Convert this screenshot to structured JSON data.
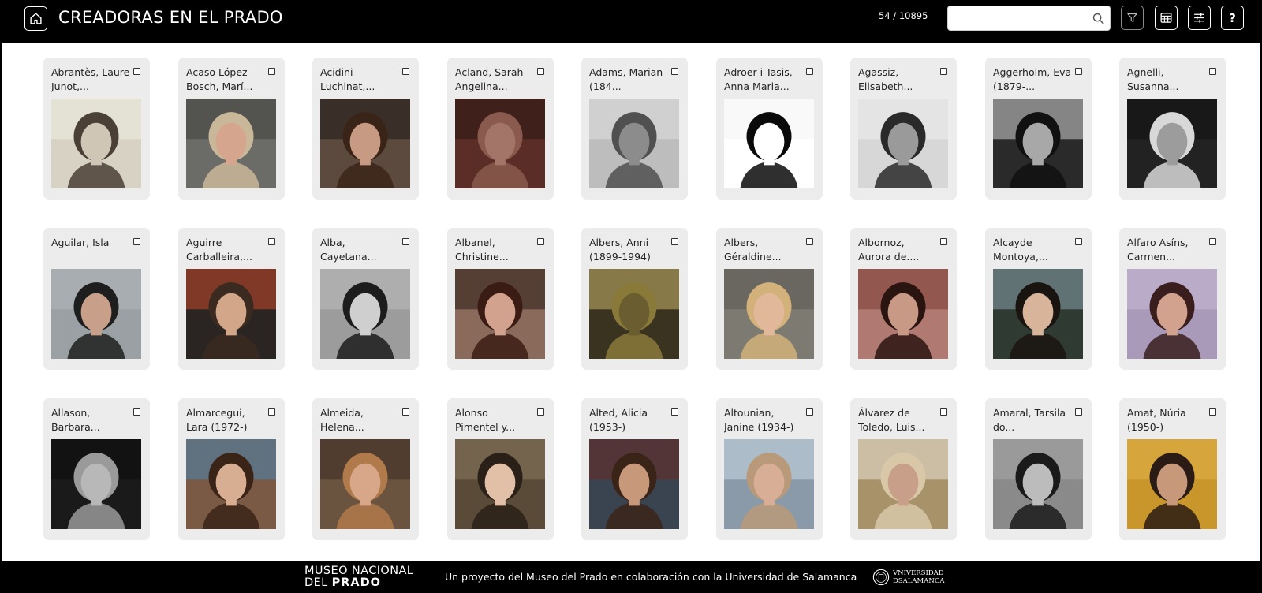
{
  "header": {
    "title": "CREADORAS EN EL PRADO",
    "counter": "54 / 10895",
    "search": {
      "value": "",
      "placeholder": ""
    },
    "buttons": [
      "filter-icon",
      "table-view-icon",
      "settings-sliders-icon",
      "help-icon"
    ],
    "help_label": "?"
  },
  "cards": [
    {
      "name": "Abrantès, Laure Junot,...",
      "tone": "#d8d2c4",
      "hair": "#4a4036",
      "skin": "#cfc6b6",
      "bg2": "#efece4"
    },
    {
      "name": "Acaso López-Bosch, Marí...",
      "tone": "#6b6b68",
      "hair": "#c9b79a",
      "skin": "#d6a58e",
      "bg2": "#3f3f3d"
    },
    {
      "name": "Acidini Luchinat,...",
      "tone": "#5c4a3e",
      "hair": "#3a2418",
      "skin": "#c79a83",
      "bg2": "#1f1a16"
    },
    {
      "name": "Acland, Sarah Angelina...",
      "tone": "#5a2e26",
      "hair": "#8a5a4e",
      "skin": "#a27568",
      "bg2": "#2c1512"
    },
    {
      "name": "Adams, Marian (184...",
      "tone": "#bdbdbd",
      "hair": "#505050",
      "skin": "#8c8c8c",
      "bg2": "#e0e0e0"
    },
    {
      "name": "Adroer i Tasis, Anna Maria...",
      "tone": "#ffffff",
      "hair": "#0a0a0a",
      "skin": "#ffffff",
      "bg2": "#f4f4f4"
    },
    {
      "name": "Agassiz, Elisabeth...",
      "tone": "#d7d7d7",
      "hair": "#2a2a2a",
      "skin": "#9a9a9a",
      "bg2": "#eeeeee"
    },
    {
      "name": "Aggerholm, Eva (1879-...",
      "tone": "#2a2a2a",
      "hair": "#111111",
      "skin": "#a8a8a8",
      "bg2": "#cfcfcf"
    },
    {
      "name": "Agnelli, Susanna...",
      "tone": "#222222",
      "hair": "#d8d8d8",
      "skin": "#9c9c9c",
      "bg2": "#111111"
    },
    {
      "name": "Aguilar, Isla",
      "tone": "#9aa0a3",
      "hair": "#1e1e1e",
      "skin": "#c8a08a",
      "bg2": "#b2b8bb"
    },
    {
      "name": "Aguirre Carballeira,...",
      "tone": "#2a2522",
      "hair": "#3a2a20",
      "skin": "#d2a688",
      "bg2": "#c74a2a"
    },
    {
      "name": "Alba, Cayetana...",
      "tone": "#9c9c9c",
      "hair": "#1c1c1c",
      "skin": "#cfcfcf",
      "bg2": "#bdbdbd"
    },
    {
      "name": "Albanel, Christine...",
      "tone": "#8a6a5a",
      "hair": "#3a1c14",
      "skin": "#d2a28e",
      "bg2": "#2a1a14"
    },
    {
      "name": "Albers, Anni (1899-1994)",
      "tone": "#3a3320",
      "hair": "#8a7a3a",
      "skin": "#6a5e30",
      "bg2": "#c9b26a"
    },
    {
      "name": "Albers, Géraldine...",
      "tone": "#7d7a72",
      "hair": "#d2b27a",
      "skin": "#e2b89a",
      "bg2": "#5a5750"
    },
    {
      "name": "Albornoz, Aurora de....",
      "tone": "#b07a72",
      "hair": "#2a1410",
      "skin": "#c89a86",
      "bg2": "#7a3a32"
    },
    {
      "name": "Alcayde Montoya,...",
      "tone": "#2f3a33",
      "hair": "#1a1410",
      "skin": "#d8b49a",
      "bg2": "#88a0a8"
    },
    {
      "name": "Alfaro Asíns, Carmen...",
      "tone": "#a89ab8",
      "hair": "#3a1e1e",
      "skin": "#d2a28e",
      "bg2": "#c8bcd6"
    },
    {
      "name": "Allason, Barbara...",
      "tone": "#1a1a1a",
      "hair": "#9a9a9a",
      "skin": "#b8b8b8",
      "bg2": "#0d0d0d"
    },
    {
      "name": "Almarcegui, Lara (1972-)",
      "tone": "#7a5a44",
      "hair": "#3a2418",
      "skin": "#d8ae92",
      "bg2": "#4a86b0"
    },
    {
      "name": "Almeida, Helena...",
      "tone": "#6a5440",
      "hair": "#b07a4a",
      "skin": "#d8a688",
      "bg2": "#3a2a20"
    },
    {
      "name": "Alonso Pimentel y...",
      "tone": "#5a4a38",
      "hair": "#2a2018",
      "skin": "#e2c0a8",
      "bg2": "#8a7a60"
    },
    {
      "name": "Alted, Alicia (1953-)",
      "tone": "#3a4450",
      "hair": "#3a2418",
      "skin": "#c8987a",
      "bg2": "#6a2a22"
    },
    {
      "name": "Altounian, Janine (1934-)",
      "tone": "#8a9aa8",
      "hair": "#b89a7a",
      "skin": "#d8ae96",
      "bg2": "#c8d8e2"
    },
    {
      "name": "Álvarez de Toledo, Luis...",
      "tone": "#a8926a",
      "hair": "#d8c8a8",
      "skin": "#c8a08a",
      "bg2": "#e8e2d6"
    },
    {
      "name": "Amaral, Tarsila do...",
      "tone": "#8a8a8a",
      "hair": "#1a1a1a",
      "skin": "#bcbcbc",
      "bg2": "#a8a8a8"
    },
    {
      "name": "Amat, Núria (1950-)",
      "tone": "#c8962a",
      "hair": "#2a1c14",
      "skin": "#c8987a",
      "bg2": "#e2b24a"
    }
  ],
  "footer": {
    "museo_line1": "MUSEO NACIONAL",
    "museo_line2a": "DEL ",
    "museo_line2b": "PRADO",
    "credit": "Un proyecto del Museo del Prado en colaboración con la Universidad de Salamanca",
    "usal_line1": "VNIVERSIDAD",
    "usal_line2": "DSALAMANCA"
  }
}
